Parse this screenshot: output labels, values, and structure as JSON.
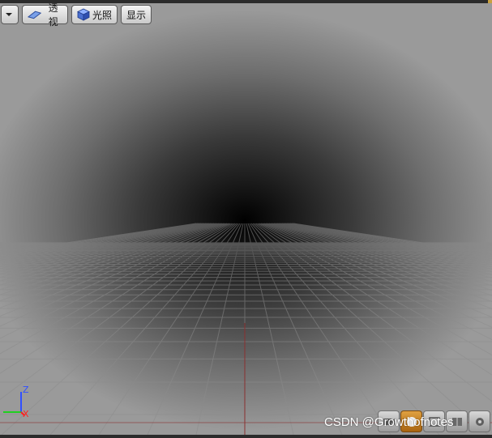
{
  "toolbar": {
    "menu_icon": "chevron-down-icon",
    "perspective_label": "透视",
    "perspective_icon": "perspective-icon",
    "lighting_label": "光照",
    "lighting_icon": "cube-icon",
    "show_label": "显示"
  },
  "axis": {
    "z_label": "Z",
    "x_label": "X"
  },
  "viewport_icons": [
    "camera-icon",
    "lighting-sphere-icon",
    "view-mode-icon",
    "layout-icon",
    "settings-icon"
  ],
  "watermark": "CSDN @Growthofnotes",
  "colors": {
    "accent": "#c8a040",
    "axis_x": "#ff2020",
    "axis_y": "#20d020",
    "axis_z": "#3050ff",
    "grid_origin": "#8a3030"
  }
}
